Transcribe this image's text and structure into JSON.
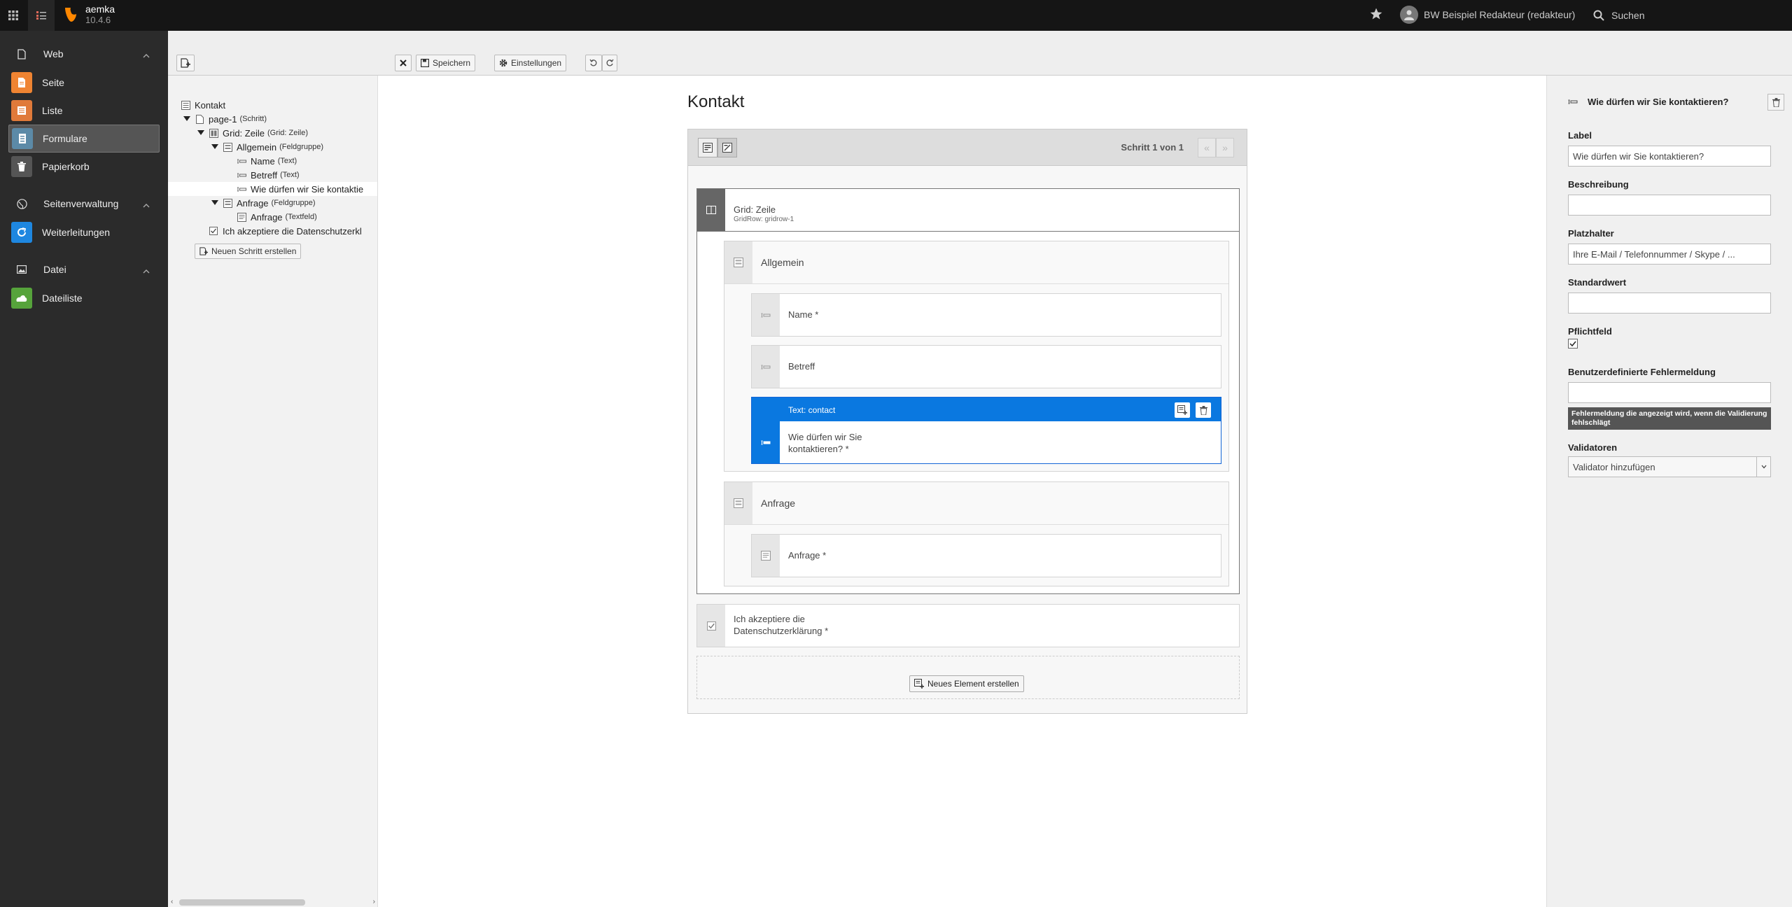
{
  "topbar": {
    "site_name": "aemka",
    "version": "10.4.6",
    "user_label": "BW Beispiel Redakteur (redakteur)",
    "search_label": "Suchen"
  },
  "modules": {
    "web": {
      "label": "Web",
      "items": [
        "Seite",
        "Liste",
        "Formulare",
        "Papierkorb"
      ]
    },
    "site": {
      "label": "Seitenverwaltung",
      "items": [
        "Weiterleitungen"
      ]
    },
    "file": {
      "label": "Datei",
      "items": [
        "Dateiliste"
      ]
    }
  },
  "docheader": {
    "save_label": "Speichern",
    "settings_label": "Einstellungen"
  },
  "tree": {
    "root": "Kontakt",
    "page": {
      "name": "page-1",
      "type": "(Schritt)"
    },
    "grid": {
      "name": "Grid: Zeile",
      "type": "(Grid: Zeile)"
    },
    "allgemein": {
      "name": "Allgemein",
      "type": "(Feldgruppe)"
    },
    "name": {
      "name": "Name",
      "type": "(Text)"
    },
    "betreff": {
      "name": "Betreff",
      "type": "(Text)"
    },
    "contact": {
      "name": "Wie dürfen wir Sie kontaktie"
    },
    "anfrage_group": {
      "name": "Anfrage",
      "type": "(Feldgruppe)"
    },
    "anfrage_field": {
      "name": "Anfrage",
      "type": "(Textfeld)"
    },
    "privacy": {
      "name": "Ich akzeptiere die Datenschutzerkl"
    },
    "new_step_label": "Neuen Schritt erstellen"
  },
  "stage": {
    "title": "Kontakt",
    "step_label": "Schritt 1 von 1",
    "prev": "«",
    "next": "»",
    "grid_label": "Grid: Zeile",
    "grid_sub": "GridRow: gridrow-1",
    "allgemein": "Allgemein",
    "name": "Name *",
    "betreff": "Betreff",
    "selected_head": "Text: contact",
    "selected_line1": "Wie dürfen wir Sie",
    "selected_line2": "kontaktieren? *",
    "anfrage_group": "Anfrage",
    "anfrage_field": "Anfrage *",
    "privacy_line1": "Ich akzeptiere die",
    "privacy_line2": "Datenschutzerklärung *",
    "new_element_label": "Neues Element erstellen"
  },
  "inspector": {
    "title": "Wie dürfen wir Sie kontaktieren?",
    "label_label": "Label",
    "label_value": "Wie dürfen wir Sie kontaktieren?",
    "description_label": "Beschreibung",
    "description_value": "",
    "placeholder_label": "Platzhalter",
    "placeholder_value": "Ihre E-Mail / Telefonnummer / Skype / ...",
    "default_label": "Standardwert",
    "default_value": "",
    "required_label": "Pflichtfeld",
    "required_checked": true,
    "error_label": "Benutzerdefinierte Fehlermeldung",
    "error_value": "",
    "error_hint": "Fehlermeldung die angezeigt wird, wenn die Validierung fehlschlägt",
    "validators_label": "Validatoren",
    "validators_value": "Validator hinzufügen"
  },
  "colors": {
    "accent": "#0a78e0",
    "topbar": "#151515",
    "module_menu": "#2b2b2b",
    "seite": "#ef8432",
    "liste": "#e07a3a",
    "formulare": "#5c8aa7",
    "papierkorb": "#555555",
    "weiterleitungen": "#1e87e0",
    "dateiliste": "#56a33b"
  }
}
